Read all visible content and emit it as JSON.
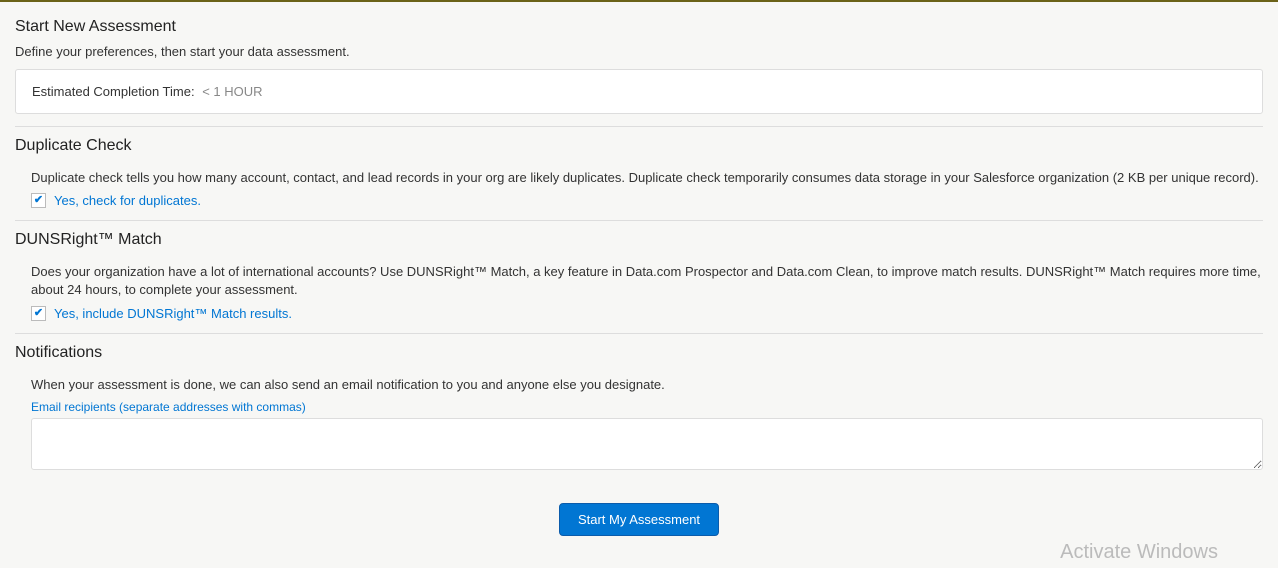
{
  "start": {
    "title": "Start New Assessment",
    "desc": "Define your preferences, then start your data assessment.",
    "estimate_label": "Estimated Completion Time:",
    "estimate_value": "< 1 HOUR"
  },
  "duplicate": {
    "title": "Duplicate Check",
    "desc": "Duplicate check tells you how many account, contact, and lead records in your org are likely duplicates. Duplicate check temporarily consumes data storage in your Salesforce organization (2 KB per unique record).",
    "checkbox_label": "Yes, check for duplicates.",
    "checked": true
  },
  "dunsright": {
    "title": "DUNSRight™ Match",
    "desc": "Does your organization have a lot of international accounts? Use DUNSRight™ Match, a key feature in Data.com Prospector and Data.com Clean, to improve match results. DUNSRight™ Match requires more time, about 24 hours, to complete your assessment.",
    "checkbox_label": "Yes, include DUNSRight™ Match results.",
    "checked": true
  },
  "notifications": {
    "title": "Notifications",
    "desc": "When your assessment is done, we can also send an email notification to you and anyone else you designate.",
    "field_label": "Email recipients (separate addresses with commas)",
    "value": ""
  },
  "action": {
    "start_button": "Start My Assessment"
  },
  "watermark": "Activate Windows"
}
